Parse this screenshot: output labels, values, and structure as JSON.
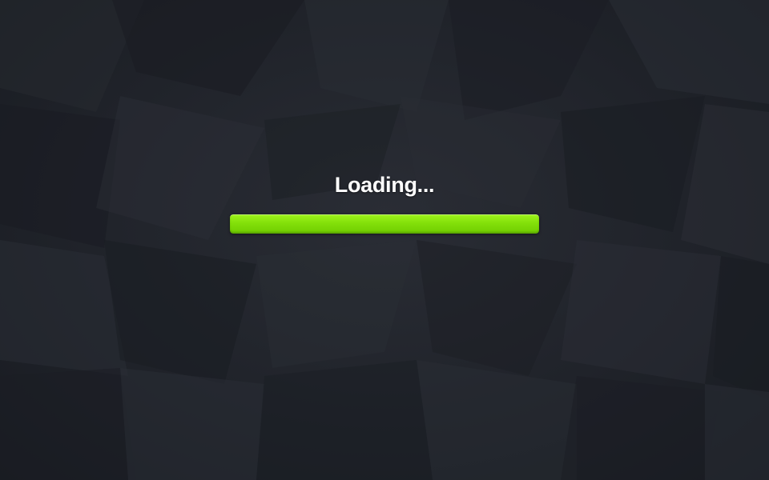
{
  "loader": {
    "status_text": "Loading...",
    "progress_fraction": 1.0
  },
  "colors": {
    "background": "#1c1f26",
    "progress_fill": "#83e00a",
    "text": "#ffffff"
  }
}
